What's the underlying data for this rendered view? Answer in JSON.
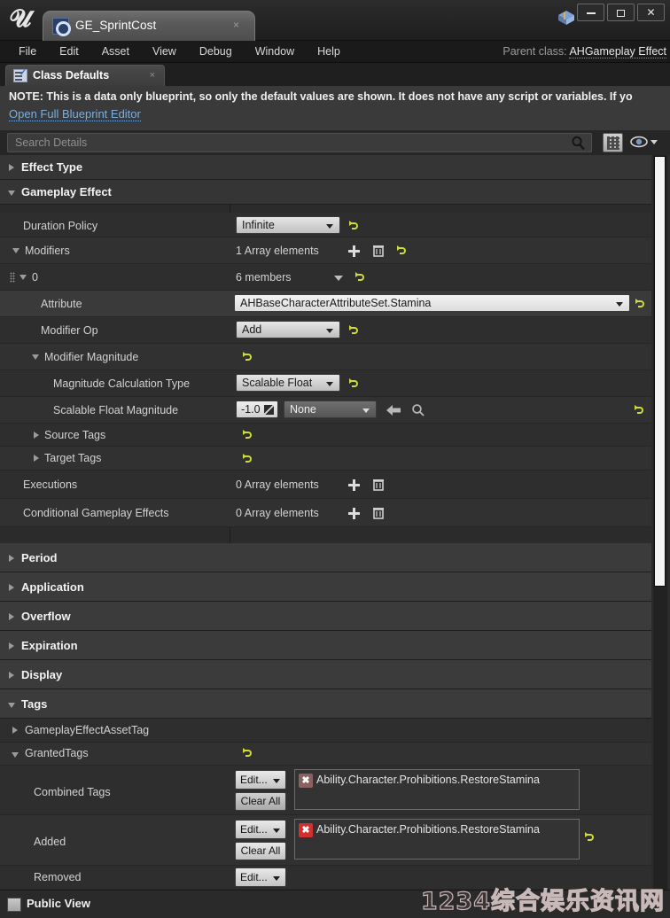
{
  "window": {
    "tab_title": "GE_SprintCost",
    "tab_close": "×",
    "minimize": "",
    "maximize": "",
    "close": "✕"
  },
  "menubar": {
    "items": [
      "File",
      "Edit",
      "Asset",
      "View",
      "Debug",
      "Window",
      "Help"
    ],
    "parent_class_label": "Parent class:",
    "parent_class_value": "AHGameplay Effect"
  },
  "doctab": {
    "label": "Class Defaults",
    "close": "×"
  },
  "note": {
    "text": "NOTE: This is a data only blueprint, so only the default values are shown.  It does not have any script or variables.  If yo",
    "link": "Open Full Blueprint Editor"
  },
  "search": {
    "placeholder": "Search Details"
  },
  "details": {
    "categories": [
      {
        "name": "Effect Type",
        "expanded": false
      },
      {
        "name": "Gameplay Effect",
        "expanded": true
      }
    ],
    "duration_policy": {
      "label": "Duration Policy",
      "value": "Infinite"
    },
    "modifiers": {
      "label": "Modifiers",
      "count_text": "1 Array elements"
    },
    "element_0": {
      "label": "0",
      "members_text": "6 members"
    },
    "attribute": {
      "label": "Attribute",
      "value": "AHBaseCharacterAttributeSet.Stamina"
    },
    "modifier_op": {
      "label": "Modifier Op",
      "value": "Add"
    },
    "modifier_magnitude": {
      "label": "Modifier Magnitude"
    },
    "magnitude_calc_type": {
      "label": "Magnitude Calculation Type",
      "value": "Scalable Float"
    },
    "scalable_float_magnitude": {
      "label": "Scalable Float Magnitude",
      "number": "-1.0",
      "curve": "None"
    },
    "source_tags": {
      "label": "Source Tags"
    },
    "target_tags": {
      "label": "Target Tags"
    },
    "executions": {
      "label": "Executions",
      "count_text": "0 Array elements"
    },
    "conditional_effects": {
      "label": "Conditional Gameplay Effects",
      "count_text": "0 Array elements"
    },
    "collapsed_categories": [
      "Period",
      "Application",
      "Overflow",
      "Expiration",
      "Display"
    ],
    "tags_category": "Tags",
    "gameplay_effect_asset_tag": {
      "label": "GameplayEffectAssetTag"
    },
    "granted_tags": {
      "label": "GrantedTags"
    },
    "combined_tags": {
      "label": "Combined Tags",
      "edit_label": "Edit...",
      "clear_label": "Clear All",
      "tag": "Ability.Character.Prohibitions.RestoreStamina",
      "tag_chip_color": "#8a6060",
      "tag_chip_glyph": "✖"
    },
    "added_tags": {
      "label": "Added",
      "edit_label": "Edit...",
      "clear_label": "Clear All",
      "tag": "Ability.Character.Prohibitions.RestoreStamina",
      "tag_chip_color": "#d03030",
      "tag_chip_glyph": "✖"
    },
    "removed_tags": {
      "label": "Removed",
      "edit_label": "Edit..."
    }
  },
  "bottom": {
    "public_view_label": "Public View"
  },
  "watermark": "1234综合娱乐资讯网",
  "colors": {
    "panel_bg": "#2b2b2b",
    "row_bg": "#2e2e2e",
    "category_bg": "#353535",
    "accent_link": "#7eaee0",
    "revert_icon": "#d2e03a",
    "scrollbar": "#f4f4f4"
  }
}
